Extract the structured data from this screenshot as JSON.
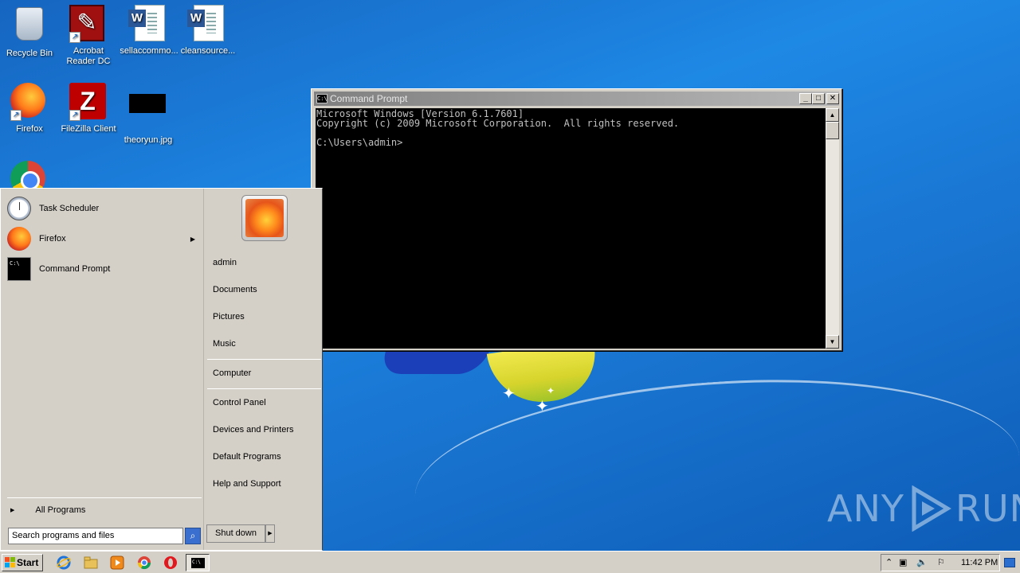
{
  "desktop": {
    "icons": [
      {
        "label": "Recycle Bin",
        "icon": "recycle-bin-icon"
      },
      {
        "label": "Acrobat Reader DC",
        "icon": "acrobat-reader-icon"
      },
      {
        "label": "sellaccommo...",
        "icon": "word-document-icon"
      },
      {
        "label": "cleansource...",
        "icon": "word-document-icon"
      },
      {
        "label": "Firefox",
        "icon": "firefox-icon"
      },
      {
        "label": "FileZilla Client",
        "icon": "filezilla-icon"
      },
      {
        "label": "theoryun.jpg",
        "icon": "image-file-icon"
      },
      {
        "label": "",
        "icon": "chrome-icon"
      }
    ]
  },
  "cmd_window": {
    "title": "Command Prompt",
    "icon_text": "C:\\",
    "lines": [
      "Microsoft Windows [Version 6.1.7601]",
      "Copyright (c) 2009 Microsoft Corporation.  All rights reserved.",
      "",
      "C:\\Users\\admin>"
    ]
  },
  "start_menu": {
    "pinned": [
      {
        "label": "Task Scheduler",
        "icon": "task-scheduler-icon"
      },
      {
        "label": "Firefox",
        "icon": "firefox-icon",
        "has_submenu": true
      },
      {
        "label": "Command Prompt",
        "icon": "command-prompt-icon"
      }
    ],
    "all_programs": "All Programs",
    "search_placeholder": "Search programs and files",
    "right_links": [
      "admin",
      "Documents",
      "Pictures",
      "Music",
      "Computer",
      "Control Panel",
      "Devices and Printers",
      "Default Programs",
      "Help and Support"
    ],
    "shutdown_label": "Shut down"
  },
  "taskbar": {
    "start_label": "Start",
    "clock": "11:42 PM",
    "pinned": [
      "internet-explorer-icon",
      "windows-explorer-icon",
      "media-player-icon",
      "chrome-icon",
      "opera-icon",
      "command-prompt-icon"
    ]
  },
  "watermark": {
    "left": "ANY",
    "right": "RUN"
  }
}
